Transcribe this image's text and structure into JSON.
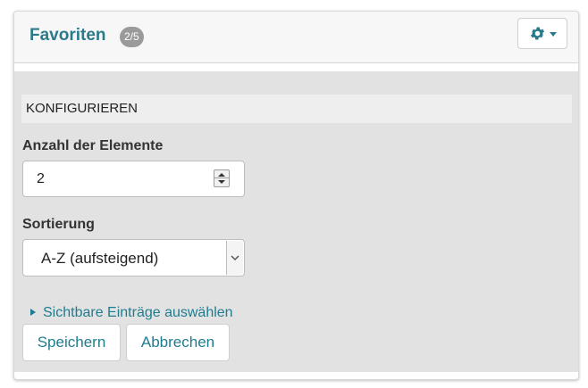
{
  "header": {
    "title": "Favoriten",
    "badge": "2/5",
    "settings_icon": "gear-icon",
    "dropdown_icon": "caret-down-icon",
    "accent_color": "#2b7a8c"
  },
  "config": {
    "section_title": "KONFIGURIEREN",
    "count_label": "Anzahl der Elemente",
    "count_value": "2",
    "sort_label": "Sortierung",
    "sort_selected": "A-Z (aufsteigend)",
    "visible_entries_link": "Sichtbare Einträge auswählen"
  },
  "actions": {
    "save_label": "Speichern",
    "cancel_label": "Abbrechen"
  }
}
